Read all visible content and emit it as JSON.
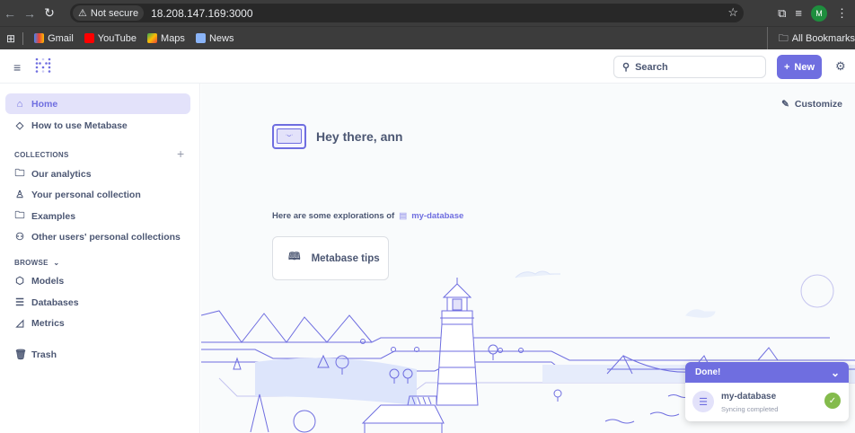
{
  "browser": {
    "not_secure_label": "Not secure",
    "url": "18.208.147.169:3000",
    "profile_initial": "M",
    "bookmarks": [
      {
        "label": "Gmail",
        "color": "#ea4335"
      },
      {
        "label": "YouTube",
        "color": "#ff0000"
      },
      {
        "label": "Maps",
        "color": "#34a853"
      },
      {
        "label": "News",
        "color": "#8ab4f8"
      }
    ],
    "all_bookmarks_label": "All Bookmarks"
  },
  "header": {
    "search_label": "Search",
    "new_label": "New",
    "accent_color": "#6f6ee0"
  },
  "sidebar": {
    "home_label": "Home",
    "how_to_label": "How to use Metabase",
    "collections_heading": "COLLECTIONS",
    "collections": [
      {
        "label": "Our analytics",
        "icon": "folder-icon"
      },
      {
        "label": "Your personal collection",
        "icon": "person-icon"
      },
      {
        "label": "Examples",
        "icon": "folder-icon"
      },
      {
        "label": "Other users' personal collections",
        "icon": "people-icon"
      }
    ],
    "browse_heading": "BROWSE",
    "browse": [
      {
        "label": "Models",
        "icon": "cube-icon"
      },
      {
        "label": "Databases",
        "icon": "database-icon"
      },
      {
        "label": "Metrics",
        "icon": "metrics-icon"
      }
    ],
    "trash_label": "Trash"
  },
  "main": {
    "customize_label": "Customize",
    "greeting": "Hey there, ann",
    "explore_text": "Here are some explorations of",
    "database_name": "my-database",
    "tip_card_label": "Metabase tips"
  },
  "toast": {
    "title": "Done!",
    "item_name": "my-database",
    "item_status": "Syncing completed",
    "success_color": "#84bb4c"
  }
}
